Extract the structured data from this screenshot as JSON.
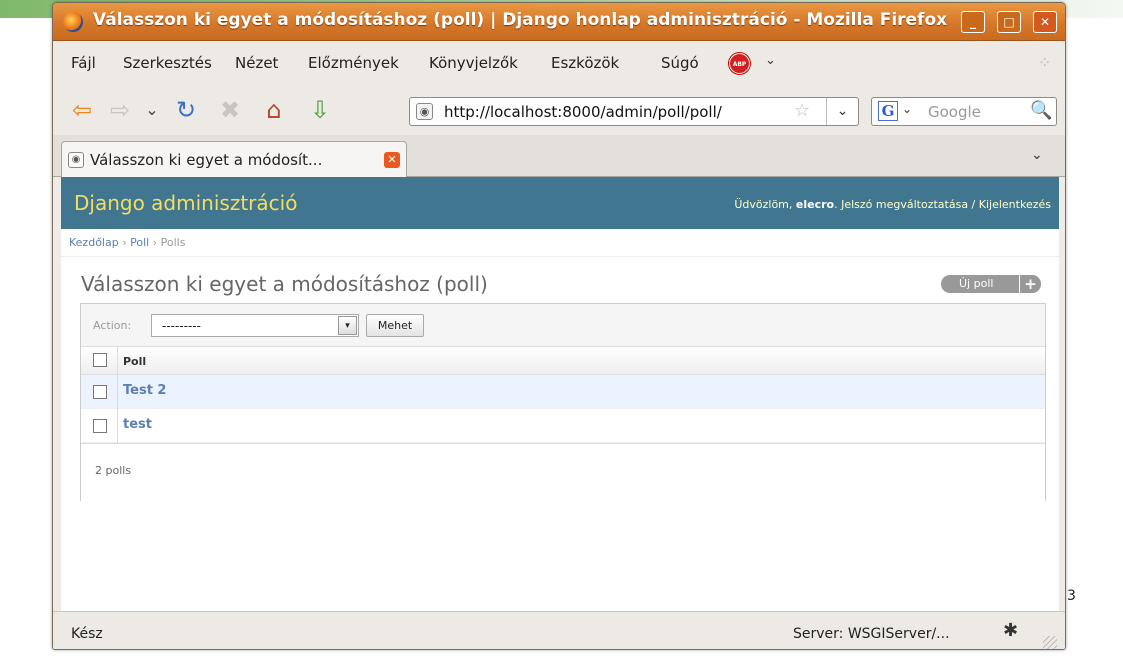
{
  "window": {
    "title": "Válasszon ki egyet a módosításhoz (poll) | Django honlap adminisztráció - Mozilla Firefox",
    "controls": {
      "minimize": "_",
      "maximize": "□",
      "close": "✕"
    }
  },
  "menu": [
    "Fájl",
    "Szerkesztés",
    "Nézet",
    "Előzmények",
    "Könyvjelzők",
    "Eszközök",
    "Súgó"
  ],
  "menu_extras": {
    "abp_label": "ABP",
    "abp_arrow": "⌄",
    "throbber": "⁘"
  },
  "nav": {
    "back_icon": "⇦",
    "forward_icon": "⇨",
    "history_icon": "⌄",
    "reload_icon": "↻",
    "stop_icon": "✖",
    "home_icon": "⌂",
    "download_icon": "⇩",
    "url": "http://localhost:8000/admin/poll/poll/",
    "star_icon": "☆",
    "url_dropdown": "⌄",
    "search_engine": "G",
    "search_dropdown": "⌄",
    "search_placeholder": "Google",
    "search_icon": "🔍"
  },
  "tab": {
    "label": "Válasszon ki egyet a módosít...",
    "close": "✕",
    "list_arrow": "⌄"
  },
  "django": {
    "brand": "Django adminisztráció",
    "welcome": "Üdvözlöm, ",
    "username": "elecro",
    "change_password": "Jelszó megváltoztatása",
    "separator": " / ",
    "logout": "Kijelentkezés",
    "breadcrumbs": [
      "Kezdőlap",
      "Poll",
      "Polls"
    ],
    "breadcrumb_sep": " › ",
    "page_title": "Válasszon ki egyet a módosításhoz (poll)",
    "add_button": "Új poll",
    "add_plus": "+",
    "action_label": "Action:",
    "action_selected": "---------",
    "action_arrow": "▾",
    "go_button": "Mehet",
    "column_header": "Poll",
    "rows": [
      "Test 2",
      "test"
    ],
    "paginator": "2 polls"
  },
  "status": {
    "left": "Kész",
    "right": "Server: WSGIServer/...",
    "bug_icon": "✱",
    "stray": "3"
  },
  "colors": {
    "django_header": "#417690",
    "brand_yellow": "#f5dd5d",
    "link": "#5b80b2",
    "row_highlight": "#edf3fe",
    "titlebar": "#d6782a"
  }
}
